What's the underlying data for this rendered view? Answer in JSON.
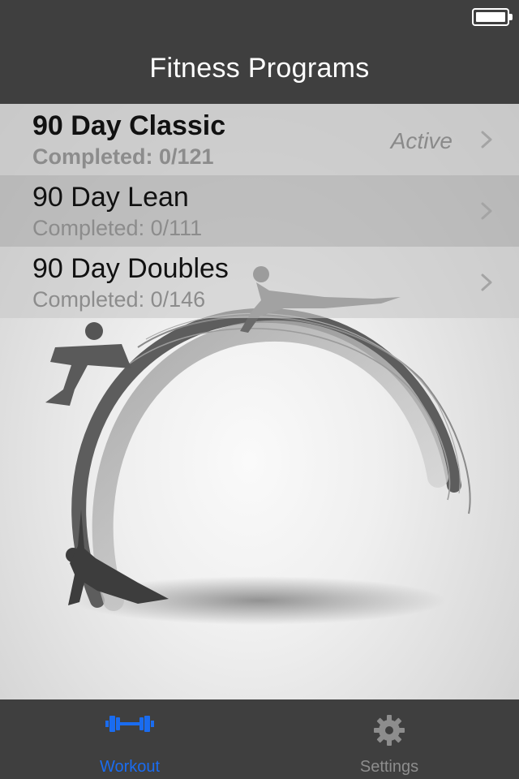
{
  "status_bar": {
    "battery_icon": "battery-full-icon"
  },
  "nav": {
    "title": "Fitness Programs"
  },
  "programs": [
    {
      "title": "90 Day Classic",
      "subtitle": "Completed: 0/121",
      "status": "Active",
      "chevron_icon": "chevron-right-icon"
    },
    {
      "title": "90 Day Lean",
      "subtitle": "Completed: 0/111",
      "status": "",
      "chevron_icon": "chevron-right-icon"
    },
    {
      "title": "90 Day Doubles",
      "subtitle": "Completed: 0/146",
      "status": "",
      "chevron_icon": "chevron-right-icon"
    }
  ],
  "tabs": [
    {
      "label": "Workout",
      "icon": "dumbbell-icon",
      "active": true
    },
    {
      "label": "Settings",
      "icon": "gear-icon",
      "active": false
    }
  ],
  "colors": {
    "bar_background": "#3f3f3f",
    "tab_active": "#1a6cf0",
    "tab_inactive": "#8d8d8d"
  }
}
